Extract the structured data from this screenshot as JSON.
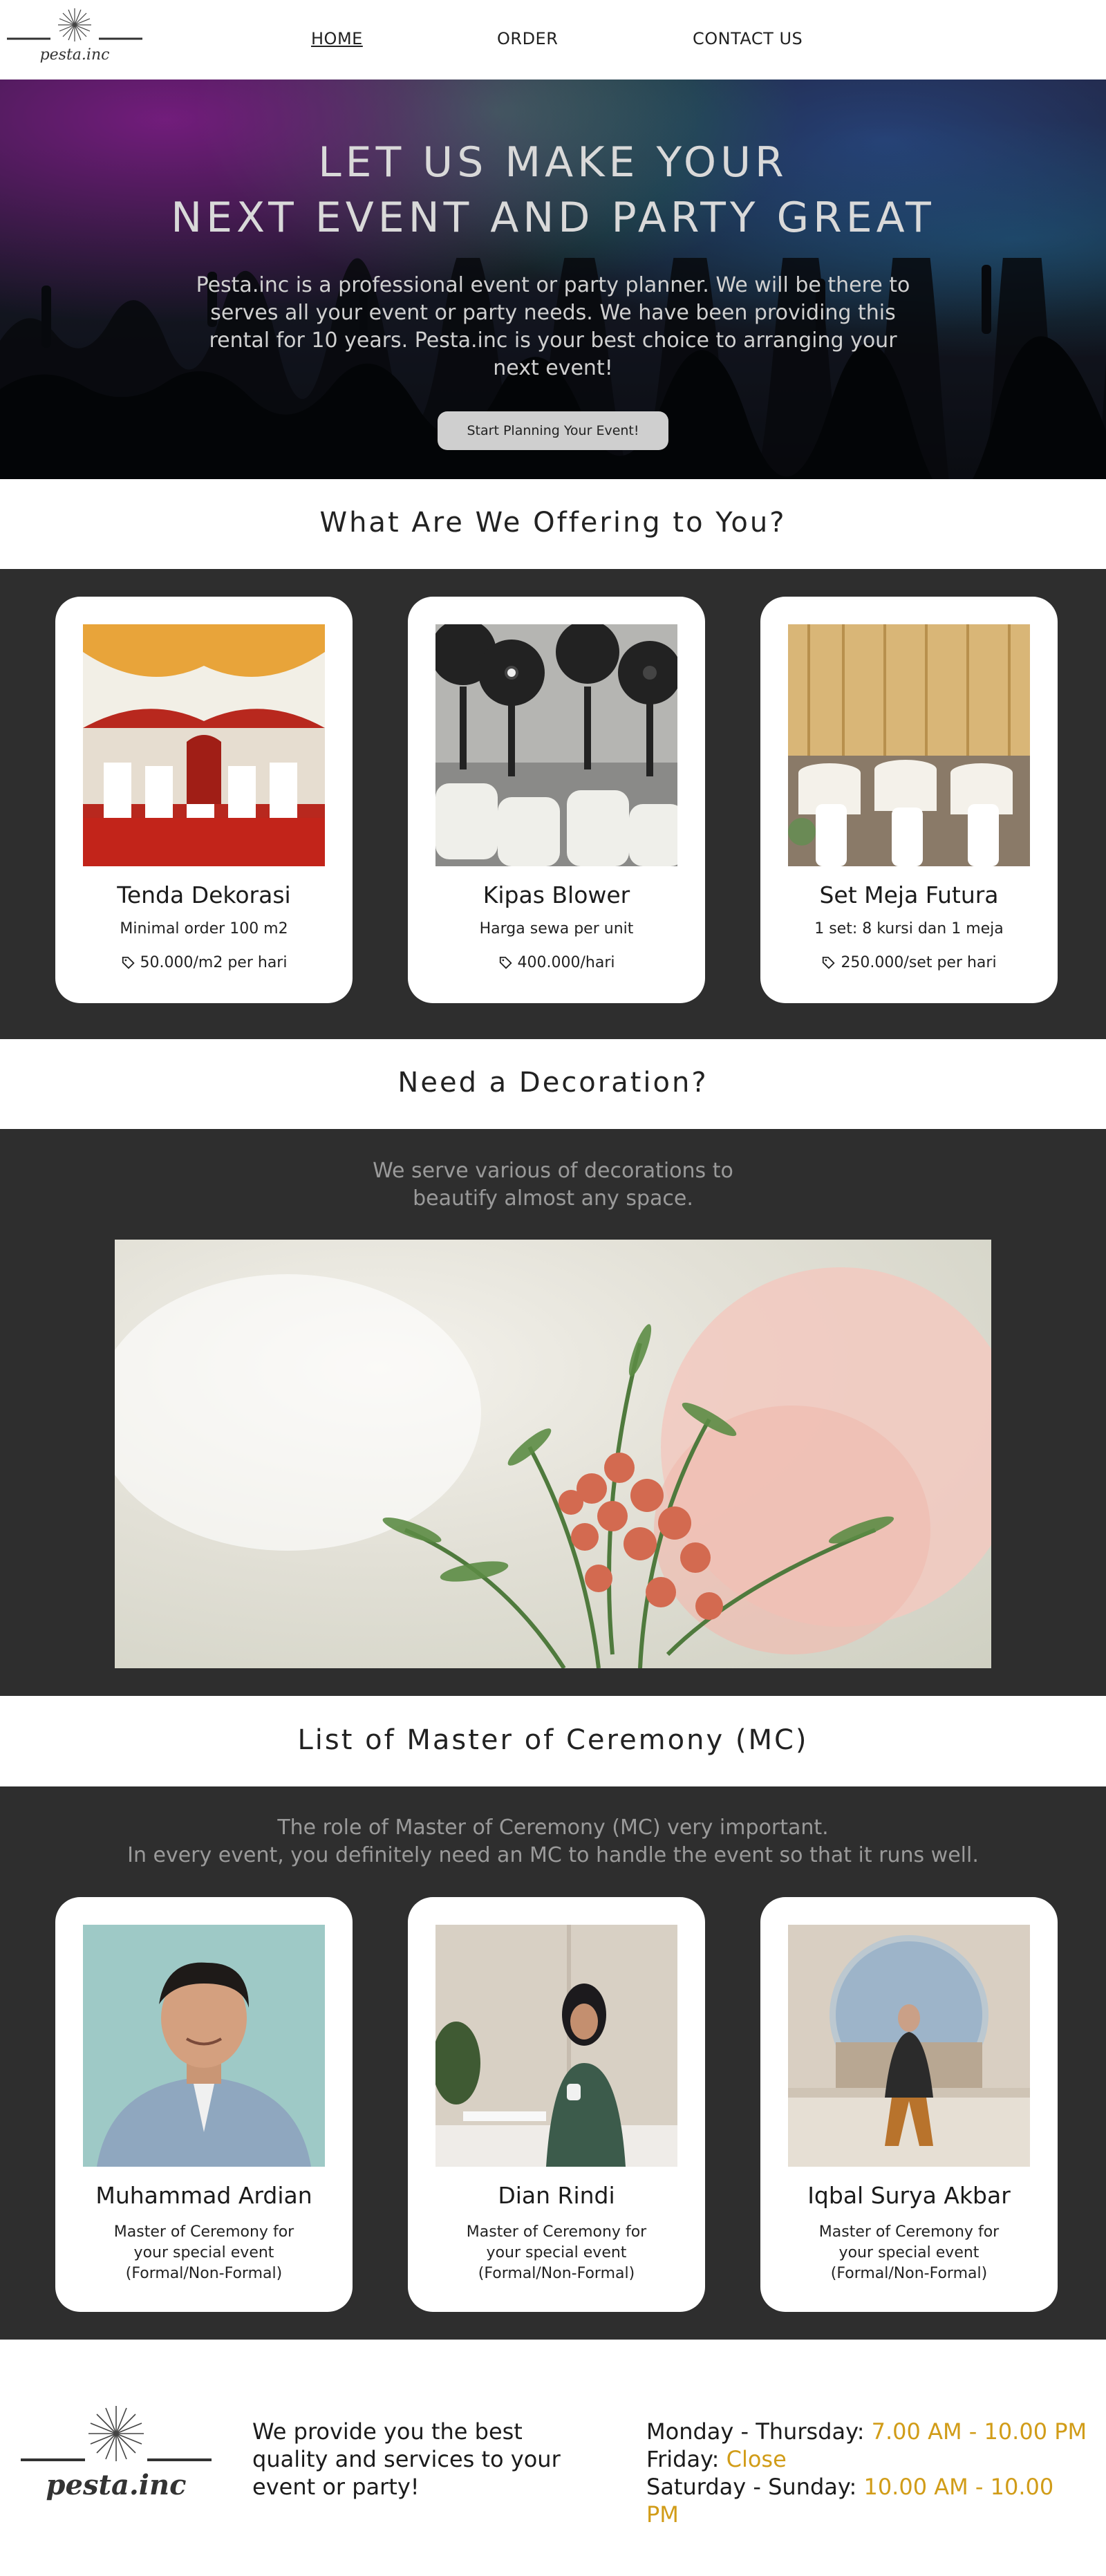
{
  "brand": {
    "name": "pesta.inc"
  },
  "nav": {
    "home": "HOME",
    "order": "ORDER",
    "contact": "CONTACT US"
  },
  "hero": {
    "title_line1": "LET US MAKE YOUR",
    "title_line2": "NEXT EVENT AND PARTY GREAT",
    "description": "Pesta.inc is a professional event or party planner. We will be there to serves all your event or party needs. We have been providing this rental for 10 years. Pesta.inc is your best choice to arranging your next event!",
    "cta_label": "Start Planning Your Event!"
  },
  "offering": {
    "title": "What Are We Offering to You?",
    "items": [
      {
        "name": "Tenda Dekorasi",
        "detail": "Minimal order 100 m2",
        "price": "50.000/m2 per hari"
      },
      {
        "name": "Kipas Blower",
        "detail": "Harga sewa per unit",
        "price": "400.000/hari"
      },
      {
        "name": "Set Meja Futura",
        "detail": "1 set: 8 kursi dan 1 meja",
        "price": "250.000/set per hari"
      }
    ]
  },
  "decoration": {
    "title": "Need a Decoration?",
    "subtitle_line1": "We serve various of decorations to",
    "subtitle_line2": "beautify almost any space."
  },
  "mc": {
    "title": "List of Master of Ceremony (MC)",
    "subtitle_line1": "The role of Master of Ceremony (MC) very important.",
    "subtitle_line2": "In every event, you definitely need an MC to handle the event so that it runs well.",
    "people": [
      {
        "name": "Muhammad Ardian",
        "role_line1": "Master of Ceremony for",
        "role_line2": "your special event",
        "role_line3": "(Formal/Non-Formal)"
      },
      {
        "name": "Dian Rindi",
        "role_line1": "Master of Ceremony for",
        "role_line2": "your special event",
        "role_line3": "(Formal/Non-Formal)"
      },
      {
        "name": "Iqbal Surya Akbar",
        "role_line1": "Master of Ceremony for",
        "role_line2": "your special event",
        "role_line3": "(Formal/Non-Formal)"
      }
    ]
  },
  "footer": {
    "tagline_line1": "We provide you the best",
    "tagline_line2": "quality and services to your",
    "tagline_line3": "event or party!",
    "hours": [
      {
        "day": "Monday - Thursday:",
        "time": "7.00 AM - 10.00 PM"
      },
      {
        "day": "Friday:",
        "time": "Close"
      },
      {
        "day": "Saturday - Sunday:",
        "time": "10.00 AM - 10.00 PM"
      }
    ]
  },
  "colors": {
    "dark_section": "#2e2e2e",
    "accent_hours": "#d19c18",
    "button": "#cfcfcf"
  },
  "icons": {
    "price": "price-tag-icon",
    "logo": "sunburst-logo-icon"
  }
}
